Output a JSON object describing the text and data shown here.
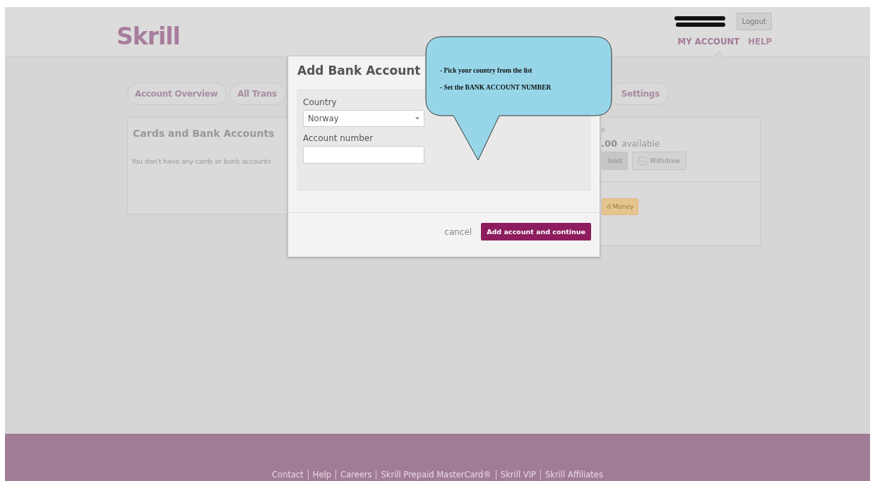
{
  "header": {
    "logo": "Skrill",
    "logout": "Logout",
    "nav": [
      {
        "label": "MY ACCOUNT",
        "selected": true
      },
      {
        "label": "HELP",
        "selected": false
      }
    ]
  },
  "tabs": [
    {
      "label": "Account Overview"
    },
    {
      "label": "All Trans"
    },
    {
      "label": "Settings"
    }
  ],
  "cards_panel": {
    "title": "Cards and Bank Accounts",
    "message": "You don't have any cards or bank accounts"
  },
  "balance_panel": {
    "label": "e",
    "amount": ".00",
    "available": "available",
    "buttons": [
      {
        "label": "load",
        "kind": "plain"
      },
      {
        "label": "Withdraw",
        "kind": "icon"
      }
    ],
    "send_button": "d Money"
  },
  "dialog": {
    "title": "Add Bank Account",
    "country_label": "Country",
    "country_value": "Norway",
    "account_label": "Account number",
    "cancel": "cancel",
    "submit": "Add account and continue"
  },
  "callout": {
    "lines": [
      "- Pick your country from the list",
      "- Set the BANK ACCOUNT NUMBER"
    ]
  },
  "footer": {
    "links": [
      "Contact",
      "Help",
      "Careers",
      "Skrill Prepaid MasterCard®",
      "Skrill VIP",
      "Skrill Affiliates"
    ]
  }
}
